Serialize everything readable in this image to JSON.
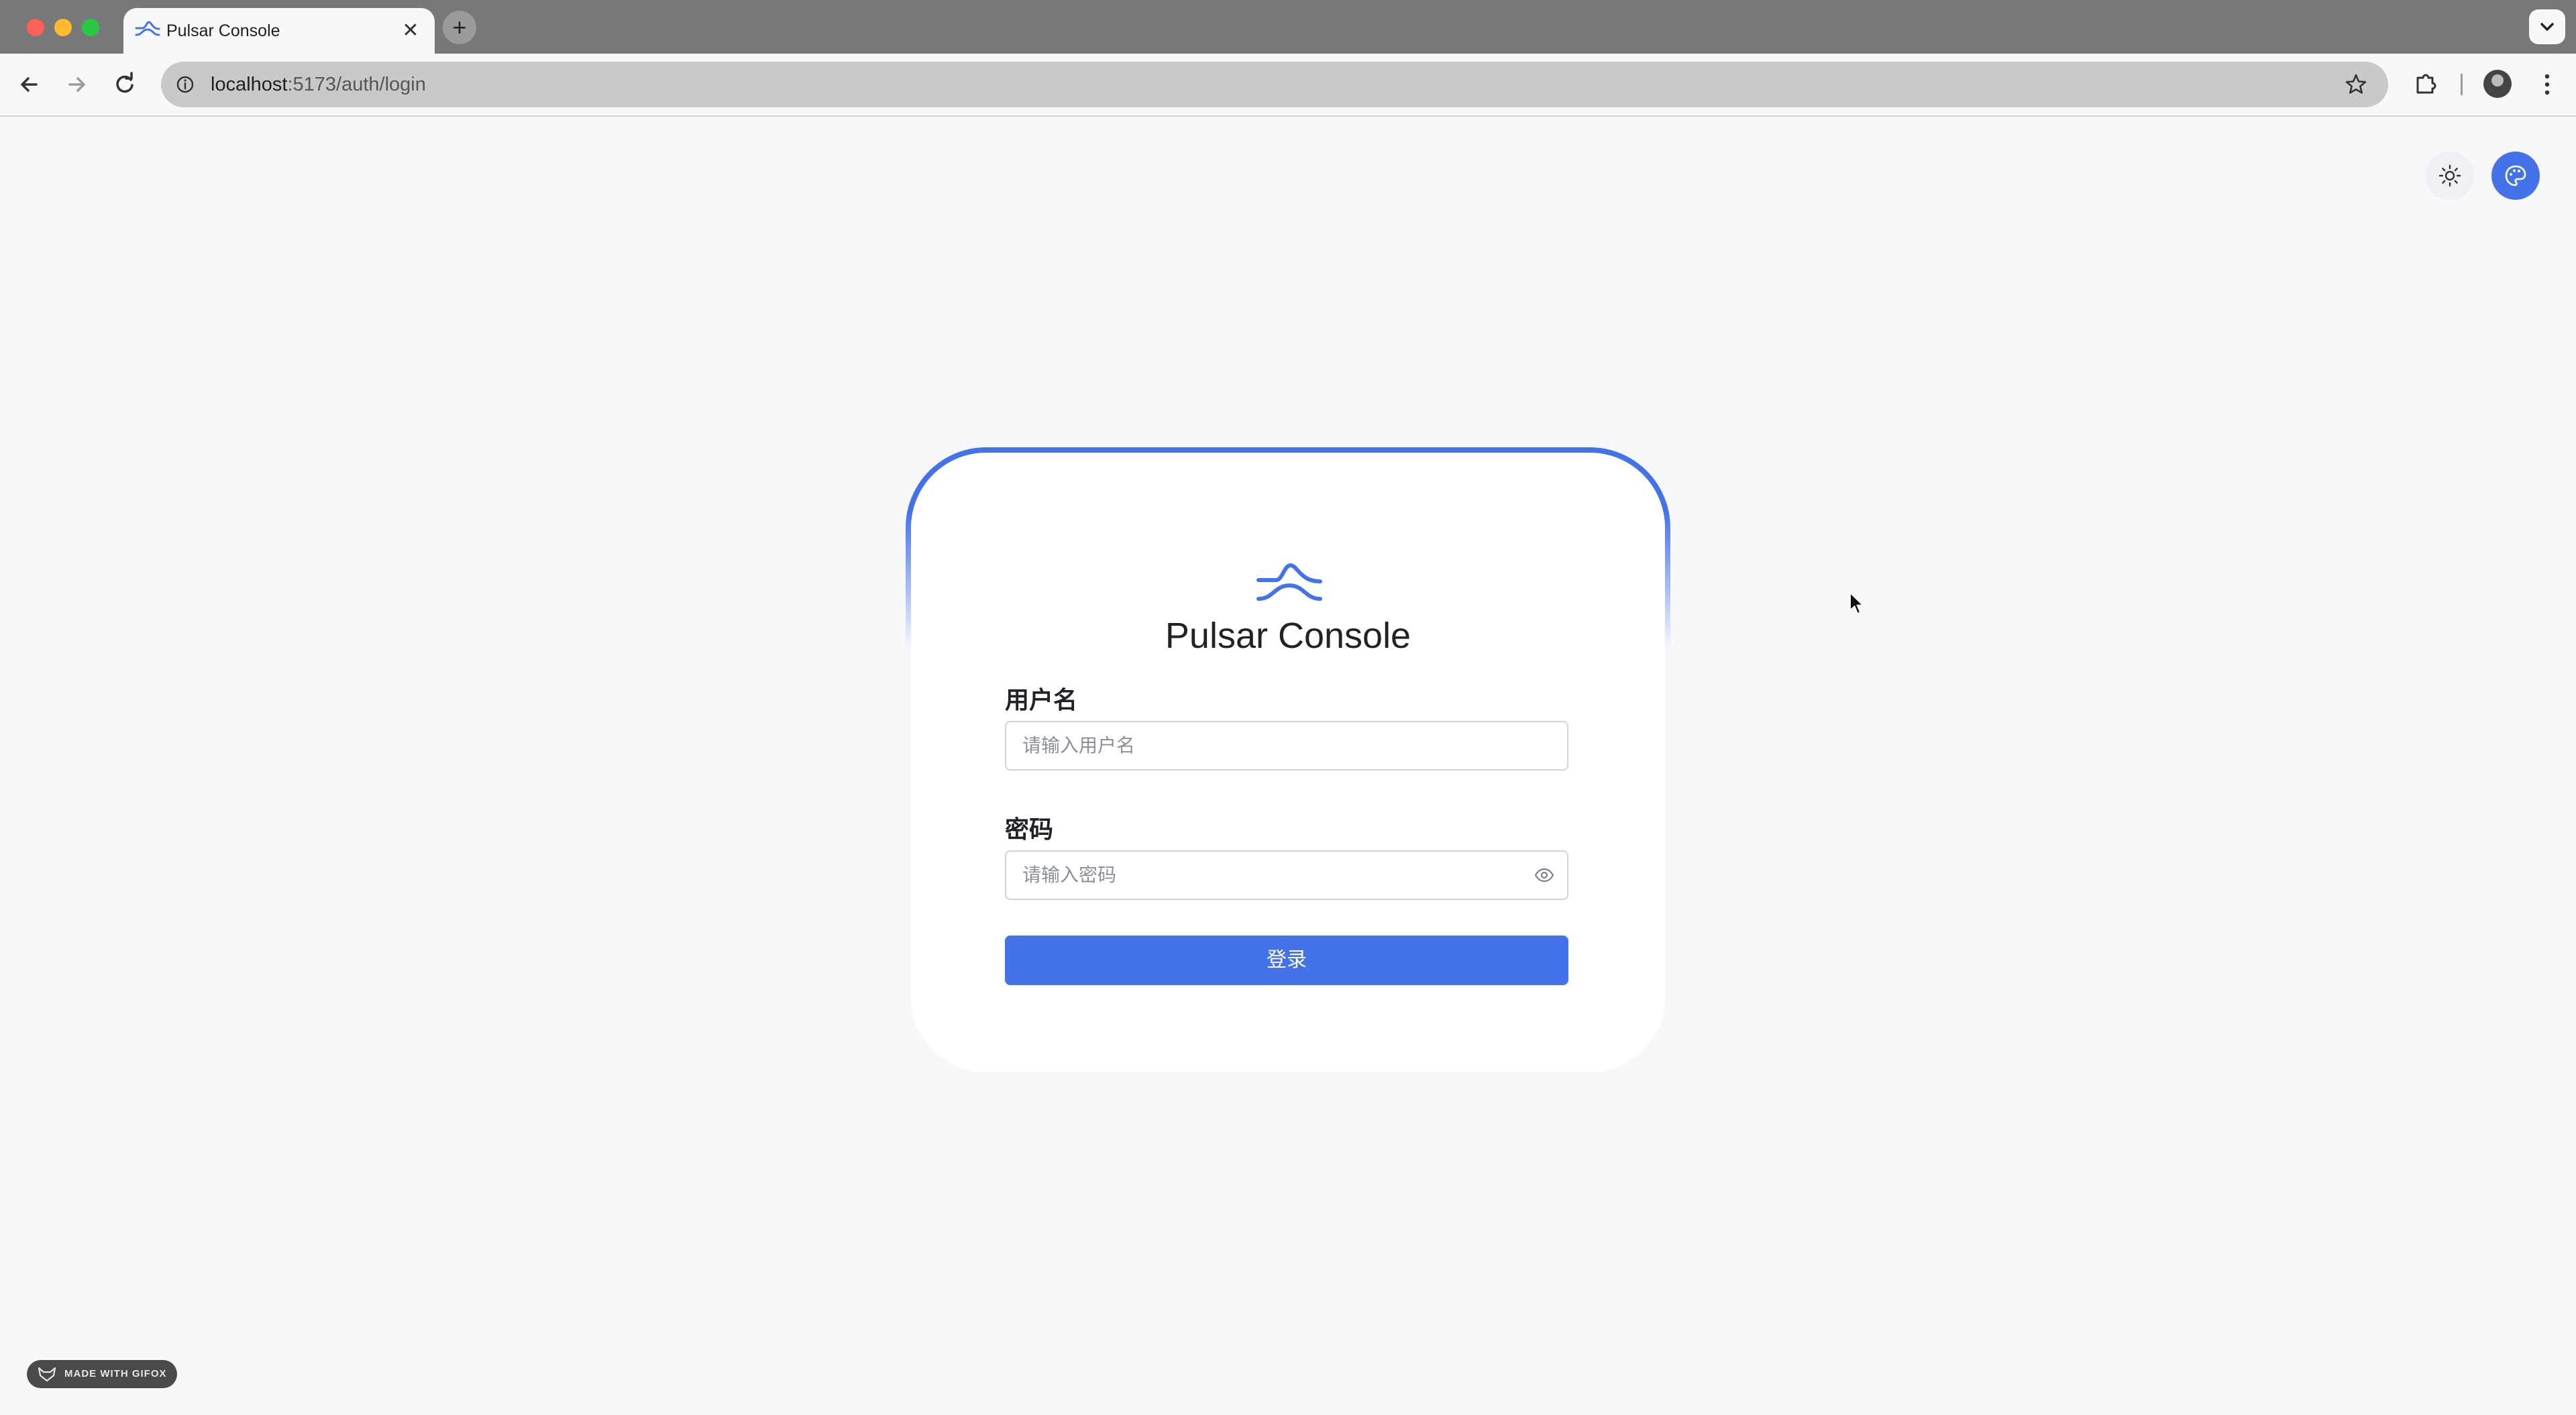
{
  "browser": {
    "tab_title": "Pulsar Console",
    "new_tab_symbol": "+",
    "close_symbol": "✕",
    "url_host": "localhost",
    "url_path": ":5173/auth/login"
  },
  "page": {
    "app_title": "Pulsar Console",
    "username_label": "用户名",
    "username_placeholder": "请输入用户名",
    "password_label": "密码",
    "password_placeholder": "请输入密码",
    "submit_label": "登录"
  },
  "watermark": "MADE WITH GIFOX",
  "colors": {
    "accent": "#4472e8",
    "background": "#f7f8fa"
  },
  "icons": [
    "pulsar-logo-icon",
    "sun-icon",
    "palette-icon",
    "eye-icon",
    "star-icon",
    "puzzle-icon"
  ]
}
